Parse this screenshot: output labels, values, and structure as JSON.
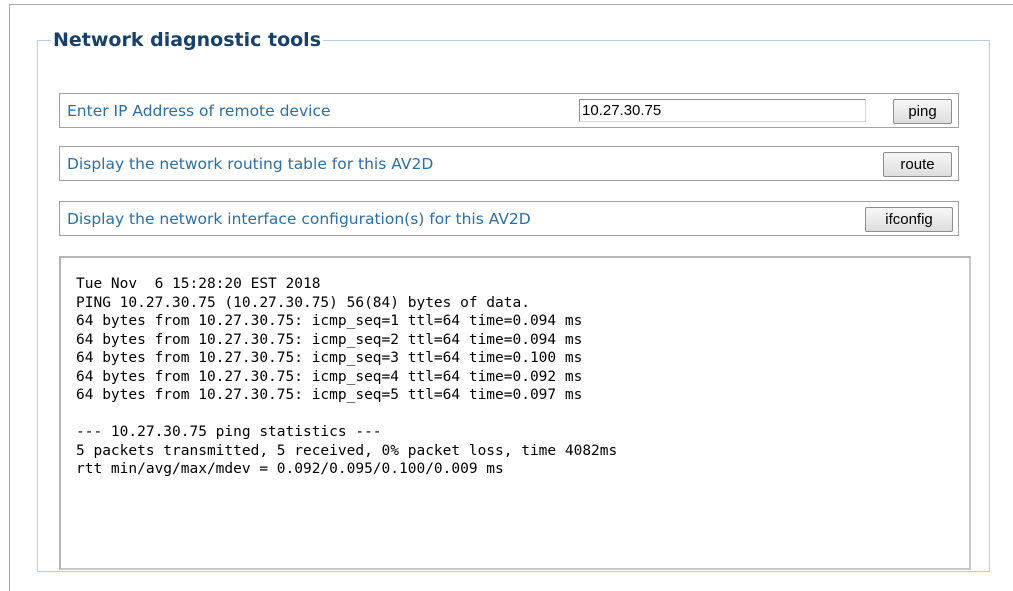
{
  "panel": {
    "title": "Network diagnostic tools"
  },
  "ping_row": {
    "label": "Enter IP Address of remote device",
    "ip_value": "10.27.30.75",
    "button_label": "ping"
  },
  "route_row": {
    "label": "Display the network routing table for this AV2D",
    "button_label": "route"
  },
  "ifconfig_row": {
    "label": "Display the network interface configuration(s) for this AV2D",
    "button_label": "ifconfig"
  },
  "output": {
    "lines": [
      "Tue Nov  6 15:28:20 EST 2018",
      "PING 10.27.30.75 (10.27.30.75) 56(84) bytes of data.",
      "64 bytes from 10.27.30.75: icmp_seq=1 ttl=64 time=0.094 ms",
      "64 bytes from 10.27.30.75: icmp_seq=2 ttl=64 time=0.094 ms",
      "64 bytes from 10.27.30.75: icmp_seq=3 ttl=64 time=0.100 ms",
      "64 bytes from 10.27.30.75: icmp_seq=4 ttl=64 time=0.092 ms",
      "64 bytes from 10.27.30.75: icmp_seq=5 ttl=64 time=0.097 ms",
      "",
      "--- 10.27.30.75 ping statistics ---",
      "5 packets transmitted, 5 received, 0% packet loss, time 4082ms",
      "rtt min/avg/max/mdev = 0.092/0.095/0.100/0.009 ms"
    ]
  },
  "colors": {
    "title": "#19406a",
    "label": "#2c6fa3",
    "fieldset_border": "#b4d0e4"
  }
}
